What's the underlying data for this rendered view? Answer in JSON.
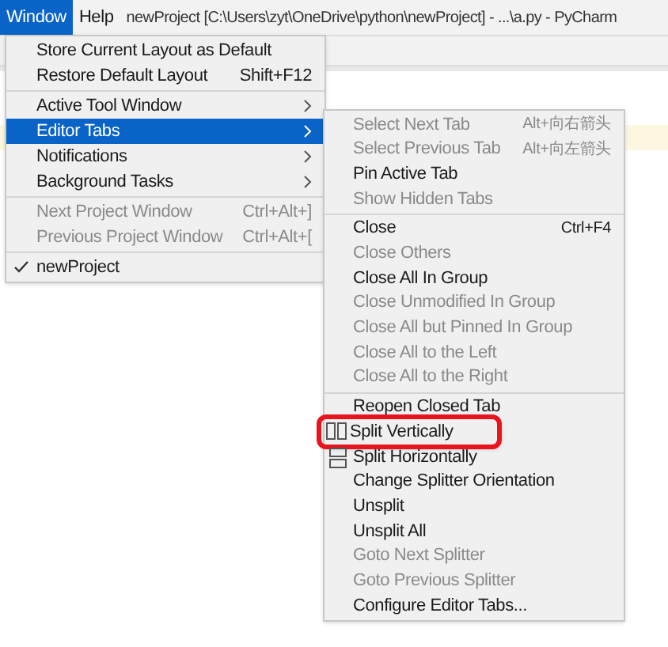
{
  "menu_bar": [
    {
      "label": "Window",
      "selected": true
    },
    {
      "label": "Help",
      "selected": false
    }
  ],
  "window": {
    "title": "newProject [C:\\Users\\zyt\\OneDrive\\python\\newProject] - ...\\a.py - PyCharm"
  },
  "window_menu": {
    "groups": [
      [
        {
          "label": "Store Current Layout as Default",
          "submenu": false,
          "disabled": false,
          "selected": false,
          "checked": false
        },
        {
          "label": "Restore Default Layout",
          "shortcut": "Shift+F12",
          "submenu": false,
          "disabled": false,
          "selected": false,
          "checked": false
        }
      ],
      [
        {
          "label": "Active Tool Window",
          "submenu": true,
          "disabled": false,
          "selected": false,
          "checked": false
        },
        {
          "label": "Editor Tabs",
          "submenu": true,
          "disabled": false,
          "selected": true,
          "checked": false
        },
        {
          "label": "Notifications",
          "submenu": true,
          "disabled": false,
          "selected": false,
          "checked": false
        },
        {
          "label": "Background Tasks",
          "submenu": true,
          "disabled": false,
          "selected": false,
          "checked": false
        }
      ],
      [
        {
          "label": "Next Project Window",
          "shortcut": "Ctrl+Alt+]",
          "submenu": false,
          "disabled": true,
          "selected": false,
          "checked": false
        },
        {
          "label": "Previous Project Window",
          "shortcut": "Ctrl+Alt+[",
          "submenu": false,
          "disabled": true,
          "selected": false,
          "checked": false
        }
      ],
      [
        {
          "label": "newProject",
          "submenu": false,
          "disabled": false,
          "selected": false,
          "checked": true
        }
      ]
    ]
  },
  "editor_tabs_menu": {
    "groups": [
      [
        {
          "kind": "plain",
          "label": "Select Next Tab",
          "shortcut": "Alt+向右箭头",
          "disabled": true,
          "highlighted": false
        },
        {
          "kind": "plain",
          "label": "Select Previous Tab",
          "shortcut": "Alt+向左箭头",
          "disabled": true,
          "highlighted": false
        },
        {
          "kind": "plain",
          "label": "Pin Active Tab",
          "disabled": false,
          "highlighted": false
        },
        {
          "kind": "plain",
          "label": "Show Hidden Tabs",
          "disabled": true,
          "highlighted": false
        }
      ],
      [
        {
          "kind": "plain",
          "label": "Close",
          "shortcut": "Ctrl+F4",
          "disabled": false,
          "highlighted": false
        },
        {
          "kind": "plain",
          "label": "Close Others",
          "disabled": true,
          "highlighted": false
        },
        {
          "kind": "plain",
          "label": "Close All In Group",
          "disabled": false,
          "highlighted": false
        },
        {
          "kind": "plain",
          "label": "Close Unmodified In Group",
          "disabled": true,
          "highlighted": false
        },
        {
          "kind": "plain",
          "label": "Close All but Pinned In Group",
          "disabled": true,
          "highlighted": false
        },
        {
          "kind": "plain",
          "label": "Close All to the Left",
          "disabled": true,
          "highlighted": false
        },
        {
          "kind": "plain",
          "label": "Close All to the Right",
          "disabled": true,
          "highlighted": false
        }
      ],
      [
        {
          "kind": "plain",
          "label": "Reopen Closed Tab",
          "disabled": false,
          "highlighted": false
        },
        {
          "kind": "vsplit",
          "label": "Split Vertically",
          "disabled": false,
          "highlighted": true
        },
        {
          "kind": "hsplit",
          "label": "Split Horizontally",
          "disabled": false,
          "highlighted": false
        },
        {
          "kind": "plain",
          "label": "Change Splitter Orientation",
          "disabled": false,
          "highlighted": false
        },
        {
          "kind": "plain",
          "label": "Unsplit",
          "disabled": false,
          "highlighted": false
        },
        {
          "kind": "plain",
          "label": "Unsplit All",
          "disabled": false,
          "highlighted": false
        },
        {
          "kind": "plain",
          "label": "Goto Next Splitter",
          "disabled": true,
          "highlighted": false
        },
        {
          "kind": "plain",
          "label": "Goto Previous Splitter",
          "disabled": true,
          "highlighted": false
        },
        {
          "kind": "plain",
          "label": "Configure Editor Tabs...",
          "disabled": false,
          "highlighted": false
        }
      ]
    ]
  }
}
